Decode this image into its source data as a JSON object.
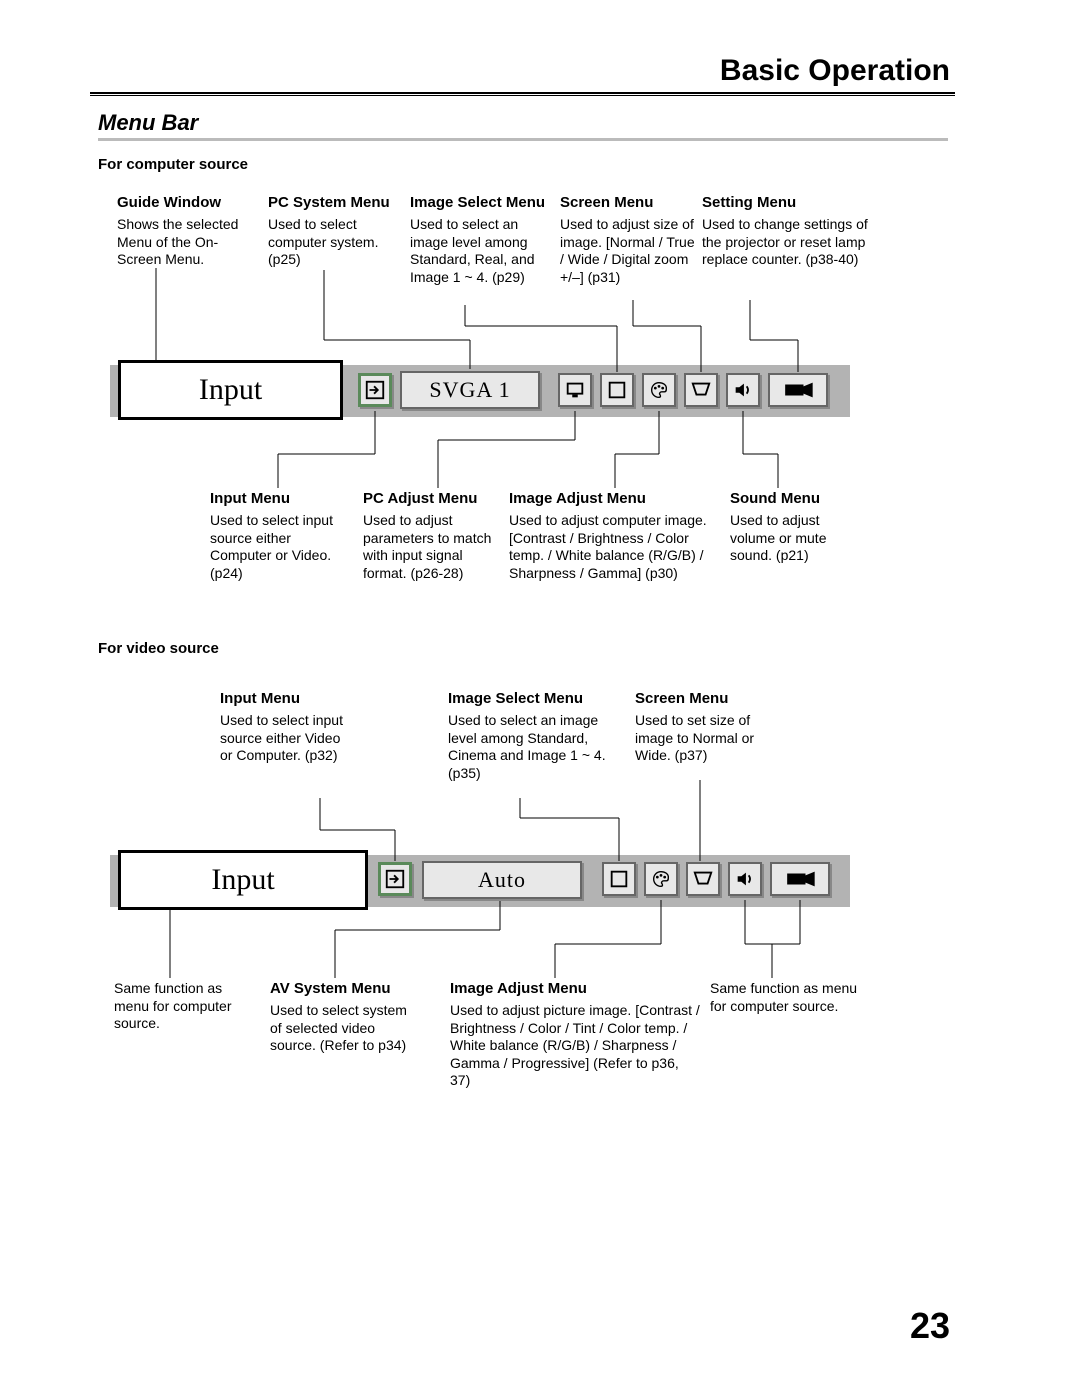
{
  "header": {
    "title": "Basic Operation"
  },
  "section": {
    "title": "Menu Bar"
  },
  "page_number": "23",
  "computer": {
    "heading": "For computer source",
    "top": {
      "guide": {
        "title": "Guide Window",
        "body": "Shows the selected Menu of the On-Screen Menu."
      },
      "pcsys": {
        "title": "PC System Menu",
        "body": "Used to select computer system. (p25)"
      },
      "imgsel": {
        "title": "Image Select Menu",
        "body": "Used to select  an image level among Standard, Real, and Image 1 ~ 4. (p29)"
      },
      "screen": {
        "title": "Screen Menu",
        "body": "Used to adjust size of image.  [Normal / True / Wide / Digital zoom +/–] (p31)"
      },
      "setting": {
        "title": "Setting Menu",
        "body": "Used to change settings of the projector or reset  lamp replace counter. (p38-40)"
      }
    },
    "bottom": {
      "input": {
        "title": "Input Menu",
        "body": "Used to select input source either Computer or Video.  (p24)"
      },
      "pcadj": {
        "title": "PC Adjust Menu",
        "body": "Used to adjust parameters to match with input signal format. (p26-28)"
      },
      "imgadj": {
        "title": "Image Adjust Menu",
        "body": "Used to adjust computer image.  [Contrast / Brightness / Color temp. /  White balance (R/G/B) / Sharpness /  Gamma]   (p30)"
      },
      "sound": {
        "title": "Sound Menu",
        "body": "Used to adjust volume or mute sound.  (p21)"
      }
    },
    "menubar": {
      "guide_label": "Input",
      "mid_label": "SVGA 1"
    }
  },
  "video": {
    "heading": "For video source",
    "top": {
      "input": {
        "title": "Input Menu",
        "body": "Used to select input source either Video or Computer.  (p32)"
      },
      "imgsel": {
        "title": "Image Select Menu",
        "body": "Used to select an image level among Standard, Cinema and Image 1 ~ 4. (p35)"
      },
      "screen": {
        "title": "Screen Menu",
        "body": "Used to set size of image to Normal or Wide. (p37)"
      }
    },
    "bottom": {
      "same_left": "Same function as menu for computer source.",
      "avsys": {
        "title": "AV System Menu",
        "body": "Used to select system of selected video source. (Refer to p34)"
      },
      "imgadj": {
        "title": "Image Adjust Menu",
        "body": " Used to adjust picture image. [Contrast / Brightness / Color / Tint / Color temp. / White balance (R/G/B) / Sharpness /  Gamma / Progressive] (Refer to p36, 37)"
      },
      "same_right": "Same function as menu for computer source."
    },
    "menubar": {
      "guide_label": "Input",
      "mid_label": "Auto"
    }
  }
}
